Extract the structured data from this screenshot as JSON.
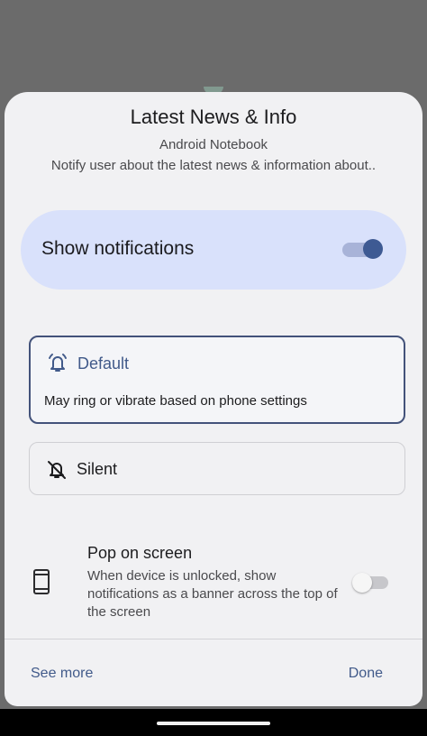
{
  "dialog": {
    "title": "Latest News & Info",
    "app_name": "Android Notebook",
    "description": "Notify user about the latest news & information about.."
  },
  "master_toggle": {
    "label": "Show notifications",
    "state": "on",
    "accent_color": "#3e5a93"
  },
  "options": [
    {
      "icon": "bell-ringing-icon",
      "title": "Default",
      "subtitle": "May ring or vibrate based on phone settings",
      "selected": true
    },
    {
      "icon": "bell-off-icon",
      "title": "Silent",
      "selected": false
    }
  ],
  "pop_on_screen": {
    "icon": "phone-icon",
    "title": "Pop on screen",
    "description": "When device is unlocked, show notifications as a banner across the top of the screen",
    "state": "off"
  },
  "footer": {
    "see_more": "See more",
    "done": "Done"
  }
}
